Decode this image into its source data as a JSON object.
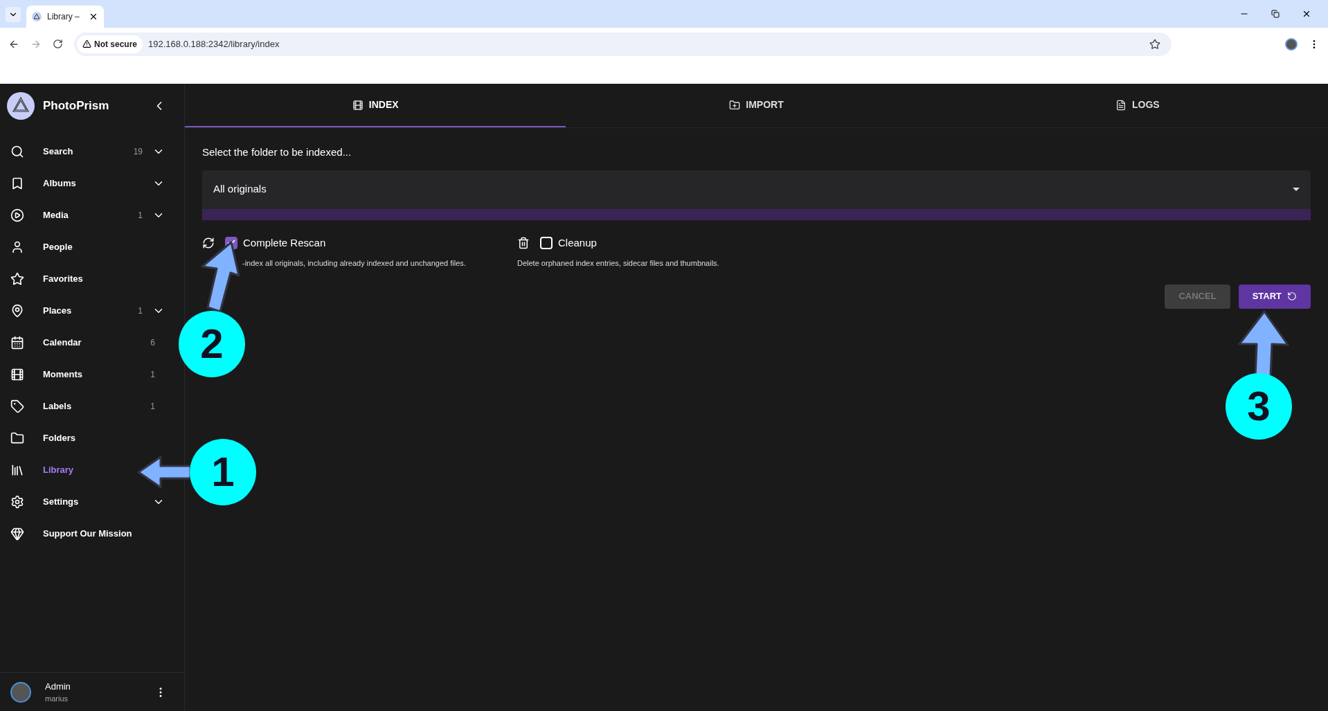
{
  "browser": {
    "tab_title": "Library –",
    "security": "Not secure",
    "url": "192.168.0.188:2342/library/index"
  },
  "sidebar": {
    "brand": "PhotoPrism",
    "items": [
      {
        "label": "Search",
        "count": "19",
        "expandable": true,
        "selected": false
      },
      {
        "label": "Albums",
        "expandable": true,
        "selected": false
      },
      {
        "label": "Media",
        "count": "1",
        "expandable": true,
        "selected": false
      },
      {
        "label": "People",
        "expandable": false,
        "selected": false
      },
      {
        "label": "Favorites",
        "expandable": false,
        "selected": false
      },
      {
        "label": "Places",
        "count": "1",
        "expandable": true,
        "selected": false
      },
      {
        "label": "Calendar",
        "count": "6",
        "expandable": false,
        "selected": false
      },
      {
        "label": "Moments",
        "count": "1",
        "expandable": false,
        "selected": false
      },
      {
        "label": "Labels",
        "count": "1",
        "expandable": false,
        "selected": false
      },
      {
        "label": "Folders",
        "expandable": false,
        "selected": false
      },
      {
        "label": "Library",
        "expandable": false,
        "selected": true
      },
      {
        "label": "Settings",
        "expandable": true,
        "selected": false
      },
      {
        "label": "Support Our Mission",
        "expandable": false,
        "selected": false
      }
    ],
    "user": {
      "name": "Admin",
      "login": "marius"
    }
  },
  "tabs": [
    {
      "label": "INDEX",
      "selected": true
    },
    {
      "label": "IMPORT",
      "selected": false
    },
    {
      "label": "LOGS",
      "selected": false
    }
  ],
  "index": {
    "prompt": "Select the folder to be indexed...",
    "folder": "All originals",
    "options": [
      {
        "label": "Complete Rescan",
        "checked": true,
        "description": "-index all originals, including already indexed and unchanged files."
      },
      {
        "label": "Cleanup",
        "checked": false,
        "description": "Delete orphaned index entries, sidecar files and thumbnails."
      }
    ],
    "buttons": [
      {
        "label": "CANCEL",
        "disabled": true
      },
      {
        "label": "START",
        "disabled": false
      }
    ]
  },
  "annotations": [
    "1",
    "2",
    "3"
  ]
}
